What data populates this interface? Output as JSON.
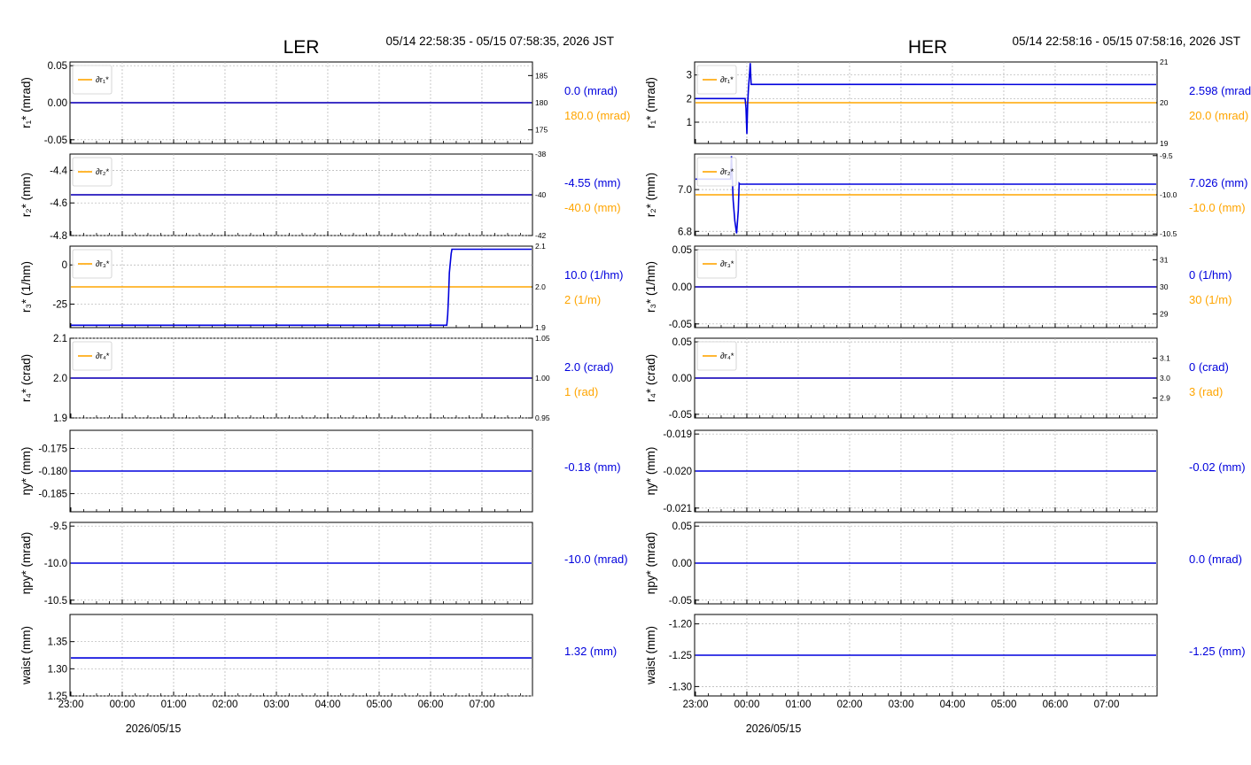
{
  "x_ticks": [
    "23:00",
    "00:00",
    "01:00",
    "02:00",
    "03:00",
    "04:00",
    "05:00",
    "06:00",
    "07:00"
  ],
  "colors": {
    "primary": "#0000dd",
    "secondary": "#ffa500",
    "grid": "#b0b0b0"
  },
  "columns": [
    {
      "title": "LER",
      "time_range": "05/14 22:58:35 - 05/15 07:58:35, 2026 JST",
      "date_label": "2026/05/15"
    },
    {
      "title": "HER",
      "time_range": "05/14 22:58:16 - 05/15 07:58:16, 2026 JST",
      "date_label": "2026/05/15"
    }
  ],
  "chart_data": [
    {
      "type": "line",
      "column": "LER",
      "row": 1,
      "ylabel": "r₁* (mrad)",
      "y2label": "",
      "legend": "∂r₁*",
      "x_range": [
        "2026/05/14 22:58:35",
        "2026/05/15 07:58:35"
      ],
      "ylim": [
        -0.055,
        0.055
      ],
      "yticks": [
        "0.05",
        "0.00",
        "-0.05"
      ],
      "ytick_values": [
        0.05,
        0.0,
        -0.05
      ],
      "y2lim": [
        172.5,
        187.5
      ],
      "y2ticks": [
        "185",
        "180",
        "175"
      ],
      "y2tick_values": [
        185,
        180,
        175
      ],
      "series": [
        {
          "axis": "left",
          "color": "primary",
          "points": [
            [
              "23:00",
              0.0
            ],
            [
              "07:58",
              0.0
            ]
          ]
        },
        {
          "axis": "right",
          "color": "secondary",
          "points": [
            [
              "23:00",
              180.0
            ],
            [
              "07:58",
              180.0
            ]
          ]
        }
      ],
      "readout_primary": "0.0 (mrad)",
      "readout_secondary": "180.0 (mrad)"
    },
    {
      "type": "line",
      "column": "LER",
      "row": 2,
      "ylabel": "r₂* (mm)",
      "legend": "∂r₂*",
      "ylim": [
        -4.8,
        -4.3
      ],
      "yticks": [
        "-4.4",
        "-4.6",
        "-4.8"
      ],
      "ytick_values": [
        -4.4,
        -4.6,
        -4.8
      ],
      "y2lim": [
        -42,
        -38
      ],
      "y2ticks": [
        "-38",
        "-40",
        "-42"
      ],
      "y2tick_values": [
        -38,
        -40,
        -42
      ],
      "series": [
        {
          "axis": "left",
          "color": "primary",
          "points": [
            [
              "23:00",
              -4.55
            ],
            [
              "07:58",
              -4.55
            ]
          ]
        },
        {
          "axis": "right",
          "color": "secondary",
          "points": [
            [
              "23:00",
              -40.0
            ],
            [
              "07:58",
              -40.0
            ]
          ]
        }
      ],
      "readout_primary": "-4.55 (mm)",
      "readout_secondary": "-40.0 (mm)"
    },
    {
      "type": "line",
      "column": "LER",
      "row": 3,
      "ylabel": "r₃* (1/hm)",
      "legend": "∂r₃*",
      "ylim": [
        -40,
        12
      ],
      "yticks": [
        "0",
        "-25"
      ],
      "ytick_values": [
        0,
        -25
      ],
      "y2lim": [
        1.9,
        2.1
      ],
      "y2ticks": [
        "2.1",
        "2.0",
        "1.9"
      ],
      "y2tick_values": [
        2.1,
        2.0,
        1.9
      ],
      "series": [
        {
          "axis": "left",
          "color": "primary",
          "points": [
            [
              "23:00",
              -38.5
            ],
            [
              "06:19",
              -38.5
            ],
            [
              "06:20",
              -32
            ],
            [
              "06:21",
              -20
            ],
            [
              "06:22",
              -5
            ],
            [
              "06:24",
              7
            ],
            [
              "06:25",
              10.0
            ],
            [
              "06:26",
              10.0
            ],
            [
              "07:58",
              10.0
            ]
          ]
        },
        {
          "axis": "right",
          "color": "secondary",
          "points": [
            [
              "23:00",
              2.0
            ],
            [
              "07:58",
              2.0
            ]
          ]
        }
      ],
      "readout_primary": "10.0 (1/hm)",
      "readout_secondary": "2 (1/m)"
    },
    {
      "type": "line",
      "column": "LER",
      "row": 4,
      "ylabel": "r₄* (crad)",
      "legend": "∂r₄*",
      "ylim": [
        1.9,
        2.1
      ],
      "yticks": [
        "2.1",
        "2.0",
        "1.9"
      ],
      "ytick_values": [
        2.1,
        2.0,
        1.9
      ],
      "y2lim": [
        0.95,
        1.05
      ],
      "y2ticks": [
        "1.05",
        "1.00",
        "0.95"
      ],
      "y2tick_values": [
        1.05,
        1.0,
        0.95
      ],
      "series": [
        {
          "axis": "left",
          "color": "primary",
          "points": [
            [
              "23:00",
              2.0
            ],
            [
              "07:58",
              2.0
            ]
          ]
        },
        {
          "axis": "right",
          "color": "secondary",
          "points": [
            [
              "23:00",
              1.0
            ],
            [
              "07:58",
              1.0
            ]
          ]
        }
      ],
      "readout_primary": "2.0 (crad)",
      "readout_secondary": "1 (rad)"
    },
    {
      "type": "line",
      "column": "LER",
      "row": 5,
      "ylabel": "ηy* (mm)",
      "legend": "",
      "ylim": [
        -0.189,
        -0.171
      ],
      "yticks": [
        "-0.175",
        "-0.180",
        "-0.185"
      ],
      "ytick_values": [
        -0.175,
        -0.18,
        -0.185
      ],
      "series": [
        {
          "axis": "left",
          "color": "primary",
          "points": [
            [
              "23:00",
              -0.18
            ],
            [
              "07:58",
              -0.18
            ]
          ]
        }
      ],
      "readout_primary": "-0.18 (mm)",
      "readout_secondary": ""
    },
    {
      "type": "line",
      "column": "LER",
      "row": 6,
      "ylabel": "ηpy* (mrad)",
      "legend": "",
      "ylim": [
        -10.55,
        -9.45
      ],
      "yticks": [
        "-9.5",
        "-10.0",
        "-10.5"
      ],
      "ytick_values": [
        -9.5,
        -10.0,
        -10.5
      ],
      "series": [
        {
          "axis": "left",
          "color": "primary",
          "points": [
            [
              "23:00",
              -10.0
            ],
            [
              "07:58",
              -10.0
            ]
          ]
        }
      ],
      "readout_primary": "-10.0 (mrad)",
      "readout_secondary": ""
    },
    {
      "type": "line",
      "column": "LER",
      "row": 7,
      "ylabel": "waist (mm)",
      "legend": "",
      "ylim": [
        1.25,
        1.4
      ],
      "yticks": [
        "1.35",
        "1.30",
        "1.25"
      ],
      "ytick_values": [
        1.35,
        1.3,
        1.25
      ],
      "series": [
        {
          "axis": "left",
          "color": "primary",
          "points": [
            [
              "23:00",
              1.32
            ],
            [
              "07:58",
              1.32
            ]
          ]
        }
      ],
      "readout_primary": "1.32 (mm)",
      "readout_secondary": ""
    },
    {
      "type": "line",
      "column": "HER",
      "row": 1,
      "ylabel": "r₁* (mrad)",
      "legend": "∂r₁*",
      "x_range": [
        "2026/05/14 22:58:16",
        "2026/05/15 07:58:16"
      ],
      "ylim": [
        0.1,
        3.55
      ],
      "yticks": [
        "3",
        "2",
        "1"
      ],
      "ytick_values": [
        3,
        2,
        1
      ],
      "y2lim": [
        19.0,
        21.0
      ],
      "y2ticks": [
        "21",
        "20",
        "19"
      ],
      "y2tick_values": [
        21,
        20,
        19
      ],
      "series": [
        {
          "axis": "left",
          "color": "primary",
          "points": [
            [
              "23:00",
              2.0
            ],
            [
              "23:58",
              2.0
            ],
            [
              "23:59",
              1.6
            ],
            [
              "00:00",
              0.5
            ],
            [
              "00:01",
              1.8
            ],
            [
              "00:02",
              2.5
            ],
            [
              "00:03",
              3.0
            ],
            [
              "00:04",
              3.5
            ],
            [
              "00:05",
              2.6
            ],
            [
              "07:58",
              2.598
            ]
          ]
        },
        {
          "axis": "right",
          "color": "secondary",
          "points": [
            [
              "23:00",
              20.0
            ],
            [
              "07:58",
              20.0
            ]
          ]
        }
      ],
      "readout_primary": "2.598 (mrad)",
      "readout_secondary": "20.0 (mrad)"
    },
    {
      "type": "line",
      "column": "HER",
      "row": 2,
      "ylabel": "r₂* (mm)",
      "legend": "∂r₂*",
      "ylim": [
        6.78,
        7.17
      ],
      "yticks": [
        "7.0",
        "6.8"
      ],
      "ytick_values": [
        7.0,
        6.8
      ],
      "y2lim": [
        -10.52,
        -9.48
      ],
      "y2ticks": [
        "-9.5",
        "-10.0",
        "-10.5"
      ],
      "y2tick_values": [
        -9.5,
        -10.0,
        -10.5
      ],
      "series": [
        {
          "axis": "left",
          "color": "primary",
          "points": [
            [
              "23:00",
              7.05
            ],
            [
              "23:41",
              7.05
            ],
            [
              "23:42",
              7.16
            ],
            [
              "23:44",
              6.95
            ],
            [
              "23:46",
              6.85
            ],
            [
              "23:48",
              6.79
            ],
            [
              "23:50",
              6.9
            ],
            [
              "23:51",
              7.03
            ],
            [
              "23:52",
              7.026
            ],
            [
              "07:58",
              7.026
            ]
          ]
        },
        {
          "axis": "right",
          "color": "secondary",
          "points": [
            [
              "23:00",
              -10.0
            ],
            [
              "07:58",
              -10.0
            ]
          ]
        }
      ],
      "readout_primary": "7.026 (mm)",
      "readout_secondary": "-10.0 (mm)"
    },
    {
      "type": "line",
      "column": "HER",
      "row": 3,
      "ylabel": "r₃* (1/hm)",
      "legend": "∂r₃*",
      "ylim": [
        -0.055,
        0.055
      ],
      "yticks": [
        "0.05",
        "0.00",
        "-0.05"
      ],
      "ytick_values": [
        0.05,
        0.0,
        -0.05
      ],
      "y2lim": [
        28.5,
        31.5
      ],
      "y2ticks": [
        "31",
        "30",
        "29"
      ],
      "y2tick_values": [
        31,
        30,
        29
      ],
      "series": [
        {
          "axis": "left",
          "color": "primary",
          "points": [
            [
              "23:00",
              0.0
            ],
            [
              "07:58",
              0.0
            ]
          ]
        },
        {
          "axis": "right",
          "color": "secondary",
          "points": [
            [
              "23:00",
              30.0
            ],
            [
              "07:58",
              30.0
            ]
          ]
        }
      ],
      "readout_primary": "0 (1/hm)",
      "readout_secondary": "30 (1/m)"
    },
    {
      "type": "line",
      "column": "HER",
      "row": 4,
      "ylabel": "r₄* (crad)",
      "legend": "∂r₄*",
      "ylim": [
        -0.055,
        0.055
      ],
      "yticks": [
        "0.05",
        "0.00",
        "-0.05"
      ],
      "ytick_values": [
        0.05,
        0.0,
        -0.05
      ],
      "y2lim": [
        2.8,
        3.2
      ],
      "y2ticks": [
        "3.1",
        "3.0",
        "2.9"
      ],
      "y2tick_values": [
        3.1,
        3.0,
        2.9
      ],
      "series": [
        {
          "axis": "left",
          "color": "primary",
          "points": [
            [
              "23:00",
              0.0
            ],
            [
              "07:58",
              0.0
            ]
          ]
        },
        {
          "axis": "right",
          "color": "secondary",
          "points": [
            [
              "23:00",
              3.0
            ],
            [
              "07:58",
              3.0
            ]
          ]
        }
      ],
      "readout_primary": "0 (crad)",
      "readout_secondary": "3 (rad)"
    },
    {
      "type": "line",
      "column": "HER",
      "row": 5,
      "ylabel": "ηy* (mm)",
      "legend": "",
      "ylim": [
        -0.0211,
        -0.0189
      ],
      "yticks": [
        "-0.019",
        "-0.020",
        "-0.021"
      ],
      "ytick_values": [
        -0.019,
        -0.02,
        -0.021
      ],
      "series": [
        {
          "axis": "left",
          "color": "primary",
          "points": [
            [
              "23:00",
              -0.02
            ],
            [
              "07:58",
              -0.02
            ]
          ]
        }
      ],
      "readout_primary": "-0.02 (mm)",
      "readout_secondary": ""
    },
    {
      "type": "line",
      "column": "HER",
      "row": 6,
      "ylabel": "ηpy* (mrad)",
      "legend": "",
      "ylim": [
        -0.055,
        0.055
      ],
      "yticks": [
        "0.05",
        "0.00",
        "-0.05"
      ],
      "ytick_values": [
        0.05,
        0.0,
        -0.05
      ],
      "series": [
        {
          "axis": "left",
          "color": "primary",
          "points": [
            [
              "23:00",
              0.0
            ],
            [
              "07:58",
              0.0
            ]
          ]
        }
      ],
      "readout_primary": "0.0 (mrad)",
      "readout_secondary": ""
    },
    {
      "type": "line",
      "column": "HER",
      "row": 7,
      "ylabel": "waist (mm)",
      "legend": "",
      "ylim": [
        -1.315,
        -1.185
      ],
      "yticks": [
        "-1.20",
        "-1.25",
        "-1.30"
      ],
      "ytick_values": [
        -1.2,
        -1.25,
        -1.3
      ],
      "series": [
        {
          "axis": "left",
          "color": "primary",
          "points": [
            [
              "23:00",
              -1.25
            ],
            [
              "07:58",
              -1.25
            ]
          ]
        }
      ],
      "readout_primary": "-1.25 (mm)",
      "readout_secondary": ""
    }
  ]
}
